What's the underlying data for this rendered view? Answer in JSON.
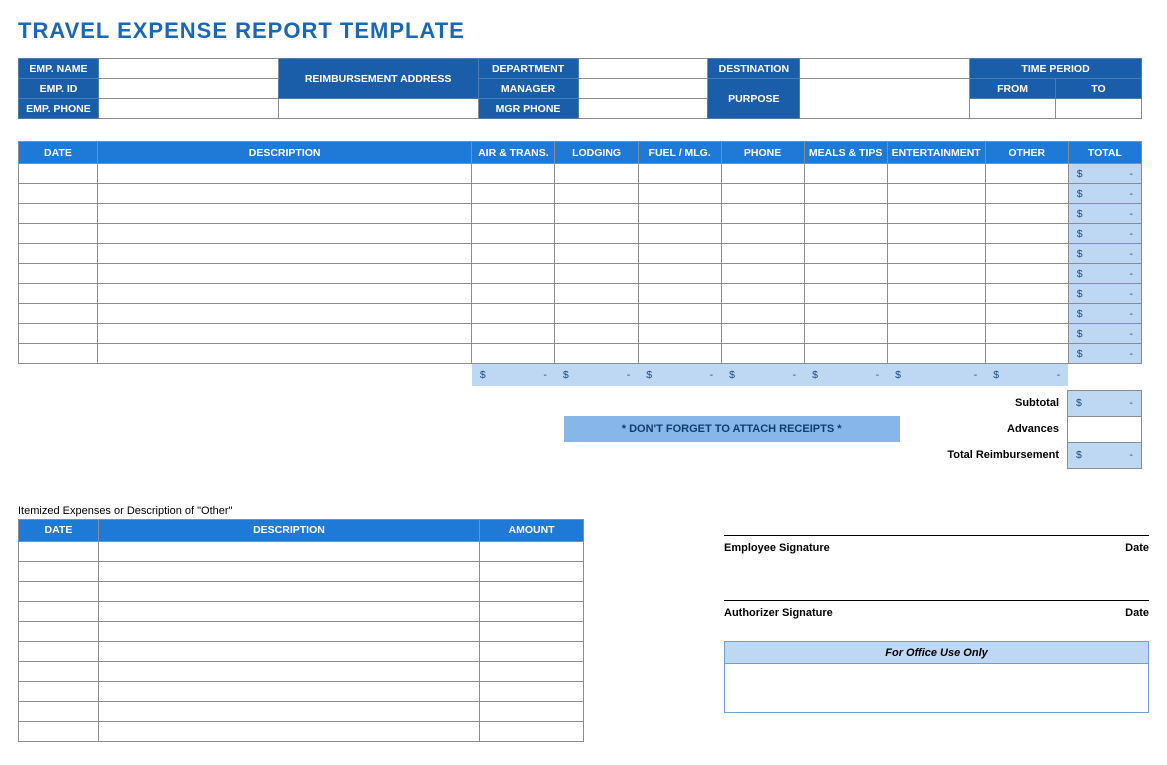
{
  "title": "TRAVEL EXPENSE REPORT TEMPLATE",
  "header": {
    "emp_name_label": "EMP. NAME",
    "emp_id_label": "EMP. ID",
    "emp_phone_label": "EMP. PHONE",
    "reimb_addr_label": "REIMBURSEMENT ADDRESS",
    "dept_label": "DEPARTMENT",
    "manager_label": "MANAGER",
    "mgr_phone_label": "MGR PHONE",
    "destination_label": "DESTINATION",
    "purpose_label": "PURPOSE",
    "time_period_label": "TIME PERIOD",
    "from_label": "FROM",
    "to_label": "TO"
  },
  "main_cols": {
    "date": "DATE",
    "desc": "DESCRIPTION",
    "air": "AIR & TRANS.",
    "lodging": "LODGING",
    "fuel": "FUEL / MLG.",
    "phone": "PHONE",
    "meals": "MEALS & TIPS",
    "ent": "ENTERTAINMENT",
    "other": "OTHER",
    "total": "TOTAL"
  },
  "currency": "$",
  "dash": "-",
  "summary": {
    "subtotal_label": "Subtotal",
    "advances_label": "Advances",
    "total_reimb_label": "Total Reimbursement",
    "receipts_note": "* DON'T FORGET TO ATTACH RECEIPTS *"
  },
  "itemized_note": "Itemized Expenses or Description of \"Other\"",
  "itemized_cols": {
    "date": "DATE",
    "desc": "DESCRIPTION",
    "amount": "AMOUNT"
  },
  "sig": {
    "employee": "Employee Signature",
    "authorizer": "Authorizer Signature",
    "date": "Date"
  },
  "office_label": "For Office Use Only"
}
